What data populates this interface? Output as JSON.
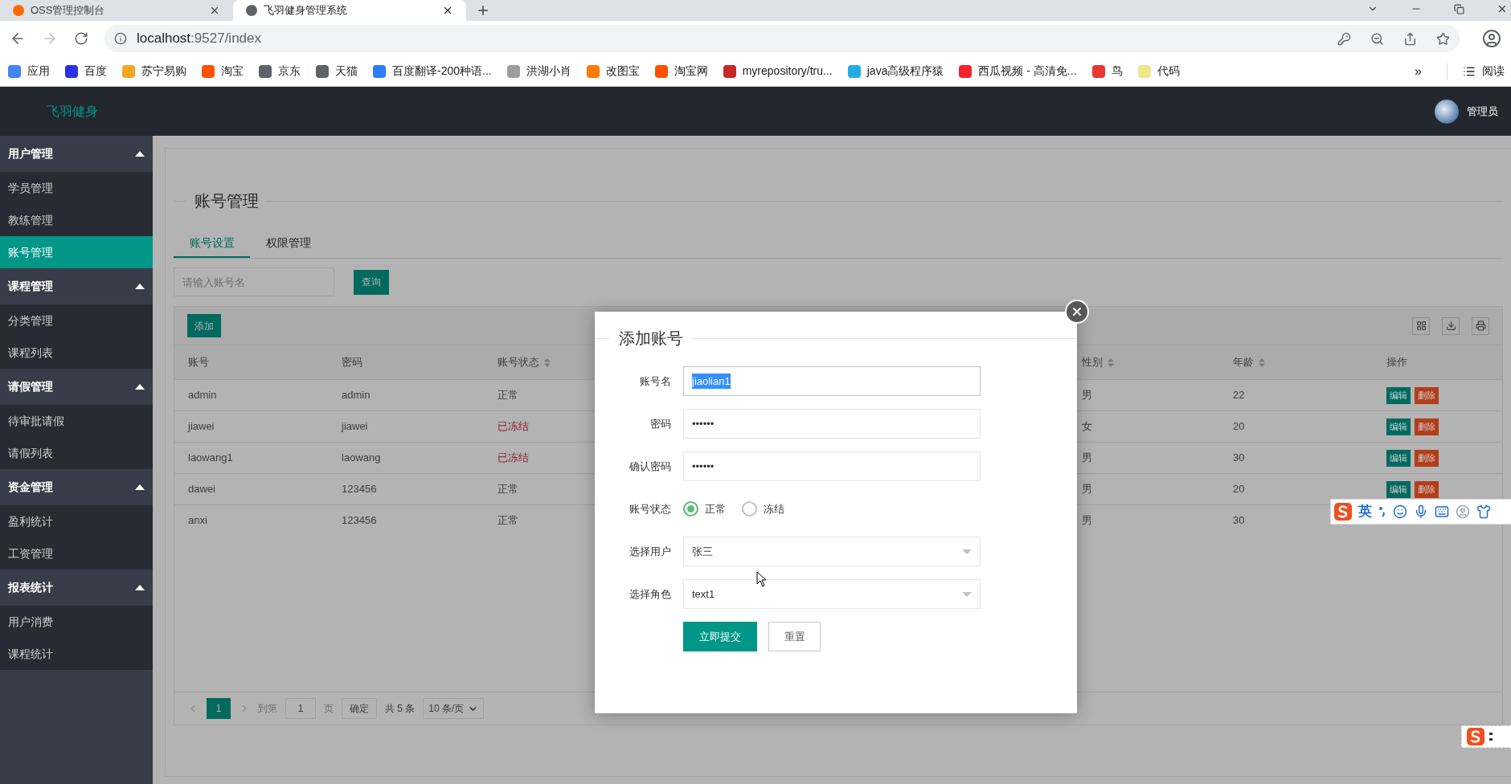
{
  "browser": {
    "tabs": [
      {
        "title": "OSS管理控制台",
        "selected": false,
        "color": "#ff6a00"
      },
      {
        "title": "飞羽健身管理系统",
        "selected": true,
        "color": "#5f6368"
      }
    ],
    "url_host": "localhost",
    "url_rest": ":9527/index",
    "bookmarks": [
      {
        "label": "应用",
        "color": "#4285f4"
      },
      {
        "label": "百度",
        "color": "#2932e1"
      },
      {
        "label": "苏宁易购",
        "color": "#f5a623"
      },
      {
        "label": "淘宝",
        "color": "#ff5000"
      },
      {
        "label": "京东",
        "color": "#5f6368"
      },
      {
        "label": "天猫",
        "color": "#5f6368"
      },
      {
        "label": "百度翻译-200种语...",
        "color": "#2b7cf6"
      },
      {
        "label": "洪湖小肖",
        "color": "#9e9e9e"
      },
      {
        "label": "改图宝",
        "color": "#ff7a00"
      },
      {
        "label": "淘宝网",
        "color": "#ff5000"
      },
      {
        "label": "myrepository/tru...",
        "color": "#c62828"
      },
      {
        "label": "java高级程序猿",
        "color": "#23ade5"
      },
      {
        "label": "西瓜视频 - 高清免...",
        "color": "#f5222d"
      },
      {
        "label": "鸟",
        "color": "#e53935"
      },
      {
        "label": "代码",
        "color": "#f0e68c"
      }
    ],
    "overflow": "»",
    "reading_list": "阅读"
  },
  "app": {
    "brand": "飞羽健身",
    "user": "管理员"
  },
  "sidebar": [
    {
      "label": "用户管理",
      "expanded": true,
      "children": [
        {
          "label": "学员管理",
          "selected": false
        },
        {
          "label": "教练管理",
          "selected": false
        },
        {
          "label": "账号管理",
          "selected": true
        }
      ]
    },
    {
      "label": "课程管理",
      "expanded": true,
      "children": [
        {
          "label": "分类管理",
          "selected": false
        },
        {
          "label": "课程列表",
          "selected": false
        }
      ]
    },
    {
      "label": "请假管理",
      "expanded": true,
      "children": [
        {
          "label": "待审批请假",
          "selected": false
        },
        {
          "label": "请假列表",
          "selected": false
        }
      ]
    },
    {
      "label": "资金管理",
      "expanded": true,
      "children": [
        {
          "label": "盈利统计",
          "selected": false
        },
        {
          "label": "工资管理",
          "selected": false
        }
      ]
    },
    {
      "label": "报表统计",
      "expanded": true,
      "children": [
        {
          "label": "用户消费",
          "selected": false
        },
        {
          "label": "课程统计",
          "selected": false
        }
      ]
    }
  ],
  "page": {
    "title": "账号管理",
    "tabs": [
      {
        "label": "账号设置",
        "selected": true
      },
      {
        "label": "权限管理",
        "selected": false
      }
    ],
    "search": {
      "placeholder": "请输入账号名"
    },
    "search_button": "查询",
    "add_button": "添加",
    "columns": [
      {
        "label": "账号",
        "sortable": false
      },
      {
        "label": "密码",
        "sortable": false
      },
      {
        "label": "账号状态",
        "sortable": true
      },
      {
        "label": "性别",
        "sortable": true
      },
      {
        "label": "年龄",
        "sortable": true
      },
      {
        "label": "操作",
        "sortable": false
      }
    ],
    "rows": [
      {
        "account": "admin",
        "password": "admin",
        "status": "正常",
        "frozen": false,
        "gender": "男",
        "age": "22",
        "actions": [
          "编辑",
          "删除"
        ]
      },
      {
        "account": "jiawei",
        "password": "jiawei",
        "status": "已冻结",
        "frozen": true,
        "gender": "女",
        "age": "20",
        "actions": [
          "编辑",
          "删除"
        ]
      },
      {
        "account": "laowang1",
        "password": "laowang",
        "status": "已冻结",
        "frozen": true,
        "gender": "男",
        "age": "30",
        "actions": [
          "编辑",
          "删除"
        ]
      },
      {
        "account": "dawei",
        "password": "123456",
        "status": "正常",
        "frozen": false,
        "gender": "男",
        "age": "20",
        "actions": [
          "编辑",
          "删除"
        ]
      },
      {
        "account": "anxi",
        "password": "123456",
        "status": "正常",
        "frozen": false,
        "gender": "男",
        "age": "30"
      }
    ],
    "pagination": {
      "pages": [
        {
          "label": "1",
          "selected": true
        }
      ],
      "goto": "到第",
      "page_input": "1",
      "page_unit": "页",
      "confirm": "确定",
      "total": "共 5 条",
      "per_page": "10 条/页"
    }
  },
  "dialog": {
    "title": "添加账号",
    "fields": [
      {
        "kind": "text",
        "label": "账号名",
        "value": "jiaolian1",
        "text_selected": true
      },
      {
        "kind": "text",
        "label": "密码",
        "value": "••••••",
        "text_selected": false
      },
      {
        "kind": "text",
        "label": "确认密码",
        "value": "••••••",
        "text_selected": false
      },
      {
        "kind": "radio",
        "label": "账号状态",
        "options": [
          {
            "label": "正常",
            "selected": true
          },
          {
            "label": "冻结",
            "selected": false
          }
        ]
      },
      {
        "kind": "select",
        "label": "选择用户",
        "value": "张三"
      },
      {
        "kind": "select",
        "label": "选择角色",
        "value": "text1"
      }
    ],
    "submit": "立即提交",
    "reset": "重置"
  },
  "ime": {
    "mode": "英"
  }
}
